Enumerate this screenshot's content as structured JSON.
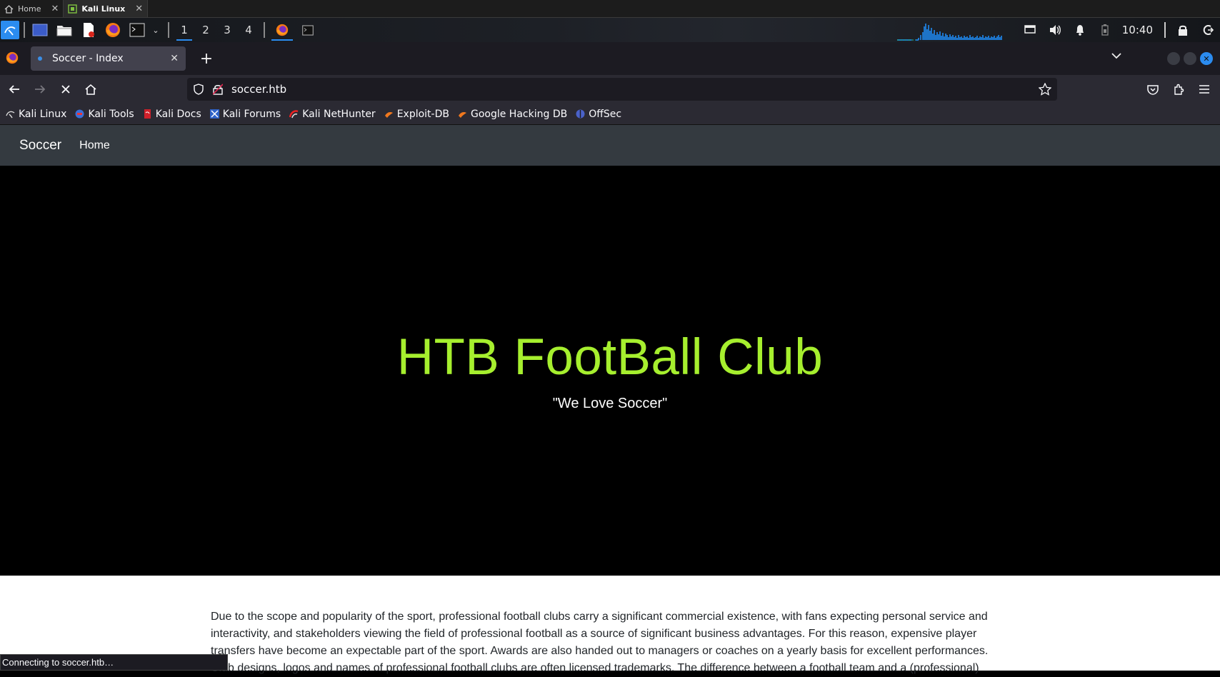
{
  "vm_tabs": [
    {
      "label": "Home",
      "icon": "home-icon",
      "active": false
    },
    {
      "label": "Kali Linux",
      "icon": "vm-icon",
      "active": true
    }
  ],
  "panel": {
    "workspaces": [
      "1",
      "2",
      "3",
      "4"
    ],
    "active_workspace": "1",
    "clock": "10:40"
  },
  "browser": {
    "tab_title": "Soccer - Index",
    "url": "soccer.htb",
    "bookmarks": [
      "Kali Linux",
      "Kali Tools",
      "Kali Docs",
      "Kali Forums",
      "Kali NetHunter",
      "Exploit-DB",
      "Google Hacking DB",
      "OffSec"
    ],
    "status": "Connecting to soccer.htb…"
  },
  "site": {
    "brand": "Soccer",
    "nav_home": "Home",
    "hero_title": "HTB FootBall Club",
    "hero_subtitle": "\"We Love Soccer\"",
    "body_text": "Due to the scope and popularity of the sport, professional football clubs carry a significant commercial existence, with fans expecting personal service and interactivity, and stakeholders viewing the field of professional football as a source of significant business advantages. For this reason, expensive player transfers have become an expectable part of the sport. Awards are also handed out to managers or coaches on a yearly basis for excellent performances. Club designs, logos and names of professional football clubs are often licensed trademarks. The difference between a football team and a (professional)"
  },
  "colors": {
    "hero_title": "#a6ef2e",
    "navbar": "#343a40",
    "accent": "#2b8cf0"
  }
}
